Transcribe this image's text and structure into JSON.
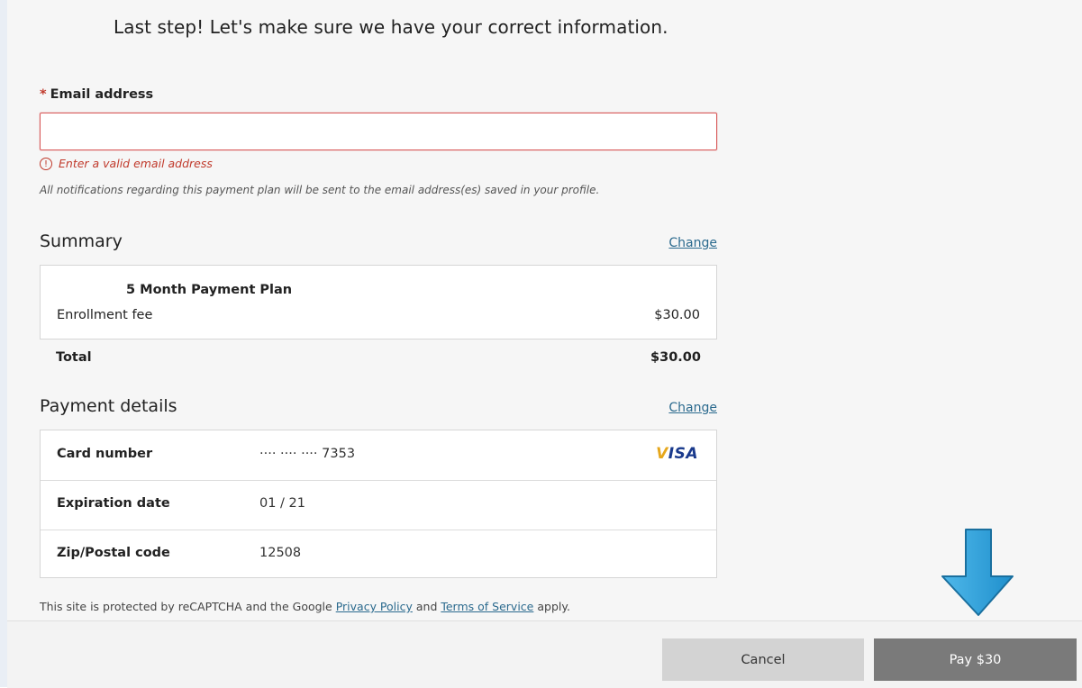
{
  "heading": "Last step! Let's make sure we have your correct information.",
  "email": {
    "required_marker": "*",
    "label": "Email address",
    "value": "",
    "error_icon": "!",
    "error": "Enter a valid email address",
    "note": "All notifications regarding this payment plan will be sent to the email address(es) saved in your profile."
  },
  "summary": {
    "title": "Summary",
    "change_label": "Change",
    "plan_name": "5 Month Payment Plan",
    "fee_label": "Enrollment fee",
    "fee_amount": "$30.00",
    "total_label": "Total",
    "total_amount": "$30.00"
  },
  "payment": {
    "title": "Payment details",
    "change_label": "Change",
    "card_number_label": "Card number",
    "card_number_value": "···· ···· ···· 7353",
    "card_brand_first": "V",
    "card_brand_rest": "ISA",
    "expiration_label": "Expiration date",
    "expiration_value": "01 / 21",
    "zip_label": "Zip/Postal code",
    "zip_value": "12508"
  },
  "recaptcha": {
    "prefix": "This site is protected by reCAPTCHA and the Google ",
    "privacy_link": "Privacy Policy",
    "and": " and ",
    "terms_link": "Terms of Service",
    "suffix": " apply."
  },
  "footer": {
    "cancel_label": "Cancel",
    "pay_label": "Pay $30"
  },
  "colors": {
    "error": "#c0392b",
    "link": "#2b6a8e",
    "pay_button": "#7a7a7a",
    "cancel_button": "#d3d3d3",
    "arrow": "#2a9fd8"
  },
  "icons": {
    "error": "error-circle-icon",
    "arrow": "arrow-down-icon",
    "card_brand": "visa-logo-icon"
  }
}
